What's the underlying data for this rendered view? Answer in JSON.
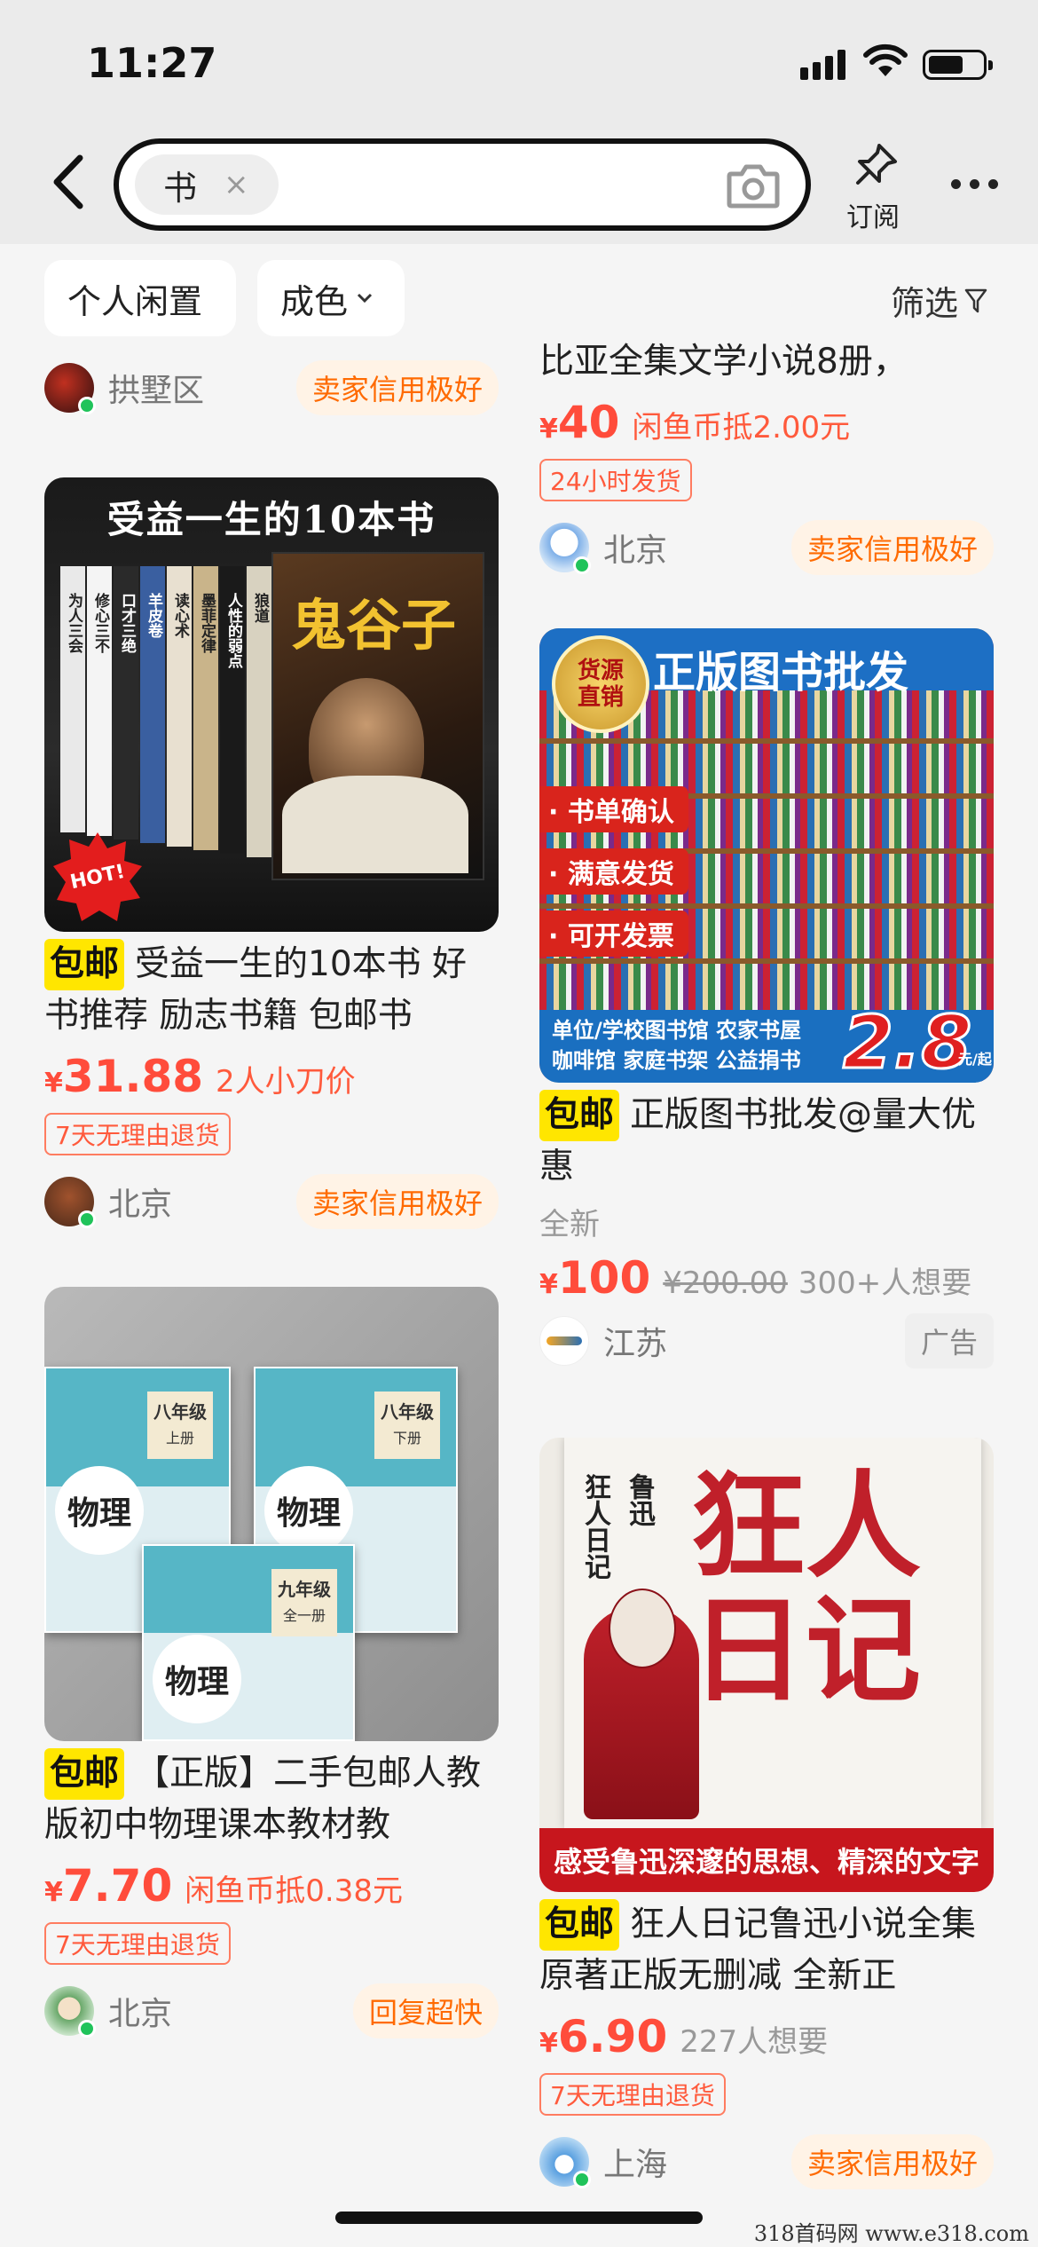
{
  "status": {
    "time": "11:27"
  },
  "search": {
    "keyword": "书",
    "clear_icon": "×"
  },
  "header": {
    "subscribe_label": "订阅"
  },
  "filters": {
    "personal": "个人闲置",
    "condition": "成色",
    "filter": "筛选"
  },
  "cards": {
    "top_left": {
      "location": "拱墅区",
      "badge": "卖家信用极好"
    },
    "top_right": {
      "title": "比亚全集文学小说8册，",
      "yen": "¥",
      "price": "40",
      "extra": "闲鱼币抵2.00元",
      "pill": "24小时发货",
      "location": "北京",
      "badge": "卖家信用极好"
    },
    "book10": {
      "img_title": "受益一生的10本书",
      "img_main": "鬼谷子",
      "img_hot": "HOT!",
      "spines": [
        "为人三会",
        "修心三不",
        "口才三绝",
        "羊皮卷",
        "读心术",
        "墨菲定律",
        "人性的弱点",
        "狼道"
      ],
      "tag": "包邮",
      "title": "受益一生的10本书 好书推荐 励志书籍 包邮书",
      "yen": "¥",
      "price": "31.88",
      "extra": "2人小刀价",
      "pill": "7天无理由退货",
      "location": "北京",
      "badge": "卖家信用极好"
    },
    "wholesale": {
      "img_seal": "货源直销",
      "img_title": "正版图书批发",
      "img_bullets": [
        "书单确认",
        "满意发货",
        "可开发票"
      ],
      "img_bottom1": "单位/学校图书馆  农家书屋",
      "img_bottom2": "咖啡馆  家庭书架  公益捐书",
      "img_price": "2.8",
      "img_unit": "元/起",
      "tag": "包邮",
      "title": "正版图书批发@量大优惠",
      "condition": "全新",
      "yen": "¥",
      "price": "100",
      "old_price": "¥200.00",
      "want": "300+人想要",
      "location": "江苏",
      "ad": "广告"
    },
    "physics": {
      "books": [
        {
          "grade": "八年级",
          "vol": "上册",
          "subject": "物理"
        },
        {
          "grade": "八年级",
          "vol": "下册",
          "subject": "物理"
        },
        {
          "grade": "九年级",
          "vol": "全一册",
          "subject": "物理"
        }
      ],
      "tag": "包邮",
      "title": "【正版】二手包邮人教版初中物理课本教材教",
      "yen": "¥",
      "price": "7.70",
      "extra": "闲鱼币抵0.38元",
      "pill": "7天无理由退货",
      "location": "北京",
      "badge": "回复超快"
    },
    "diary": {
      "img_author": "鲁迅",
      "img_small_title": "狂人日记",
      "img_big1": "狂人",
      "img_big2": "日记",
      "img_banner": "感受鲁迅深邃的思想、精深的文字",
      "tag": "包邮",
      "title": "狂人日记鲁迅小说全集原著正版无删减 全新正",
      "yen": "¥",
      "price": "6.90",
      "want": "227人想要",
      "pill": "7天无理由退货",
      "location": "上海",
      "badge": "卖家信用极好"
    }
  },
  "watermark": "318首码网  www.e318.com"
}
